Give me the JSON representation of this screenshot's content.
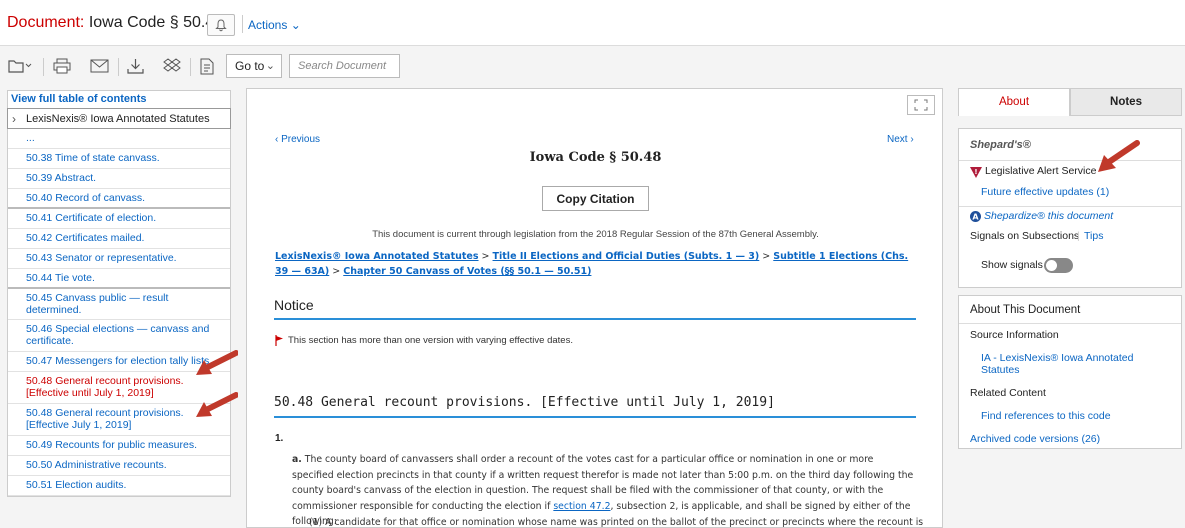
{
  "header": {
    "doc_label": "Document:",
    "doc_title": "Iowa Code § 50.48",
    "actions": "Actions"
  },
  "toolbar": {
    "goto": "Go to",
    "search_placeholder": "Search Document"
  },
  "toc": {
    "view_full": "View full table of contents",
    "root": "LexisNexis® Iowa Annotated Statutes",
    "items": [
      "...",
      "50.38 Time of state canvass.",
      "50.39 Abstract.",
      "50.40 Record of canvass.",
      "50.41 Certificate of election.",
      "50.42 Certificates mailed.",
      "50.43 Senator or representative.",
      "50.44 Tie vote.",
      "50.45 Canvass public — result determined.",
      "50.46 Special elections — canvass and certificate.",
      "50.47 Messengers for election tally lists.",
      "50.48 General recount provisions. [Effective until July 1, 2019]",
      "50.48 General recount provisions. [Effective July 1, 2019]",
      "50.49 Recounts for public measures.",
      "50.50 Administrative recounts.",
      "50.51 Election audits."
    ]
  },
  "document": {
    "previous": "Previous",
    "next": "Next",
    "heading": "Iowa Code § 50.48",
    "copy_citation": "Copy Citation",
    "currency": "This document is current through legislation from the 2018 Regular Session of the 87th General Assembly.",
    "crumb1": "LexisNexis® Iowa Annotated Statutes",
    "crumb2": "Title II Elections and Official Duties (Subts. 1 — 3)",
    "crumb3": "Subtitle 1 Elections (Chs. 39 — 63A)",
    "crumb4": "Chapter 50 Canvass of Votes (§§ 50.1 — 50.51)",
    "notice_heading": "Notice",
    "notice_text": "This section has more than one version with varying effective dates.",
    "section_heading": "50.48 General recount provisions. [Effective until July 1, 2019]",
    "num": "1.",
    "para_letter": "a.",
    "para_text_1": "The county board of canvassers shall order a recount of the votes cast for a particular office or nomination in one or more specified election precincts in that county if a written request therefor is made not later than 5:00 p.m. on the third day following the county board's canvass of the election in question. The request shall be filed with the commissioner of that county, or with the commissioner responsible for conducting the election if",
    "para_link": "section 47.2",
    "para_text_2": ", subsection 2, is applicable, and shall be signed by either of the following:",
    "para_cut": "(1) A candidate for that office or nomination whose name was printed on the ballot of the precinct or precincts where the recount is"
  },
  "right": {
    "tab_about": "About",
    "tab_notes": "Notes",
    "shepards": "Shepard's®",
    "las": "Legislative Alert Service",
    "future_updates": "Future effective updates (1)",
    "shepardize": "Shepardize® this document",
    "signals": "Signals on Subsections",
    "tips": "Tips",
    "show_signals": "Show signals",
    "about_doc": "About This Document",
    "source_info": "Source Information",
    "source_link": "IA - LexisNexis® Iowa Annotated Statutes",
    "related": "Related Content",
    "find_refs": "Find references to this code",
    "archived": "Archived code versions (26)"
  },
  "colors": {
    "accent_red": "#cc0000",
    "link_blue": "#0b66c3",
    "rule_blue": "#2a8fd8",
    "annotation_arrow": "#c0392b"
  }
}
